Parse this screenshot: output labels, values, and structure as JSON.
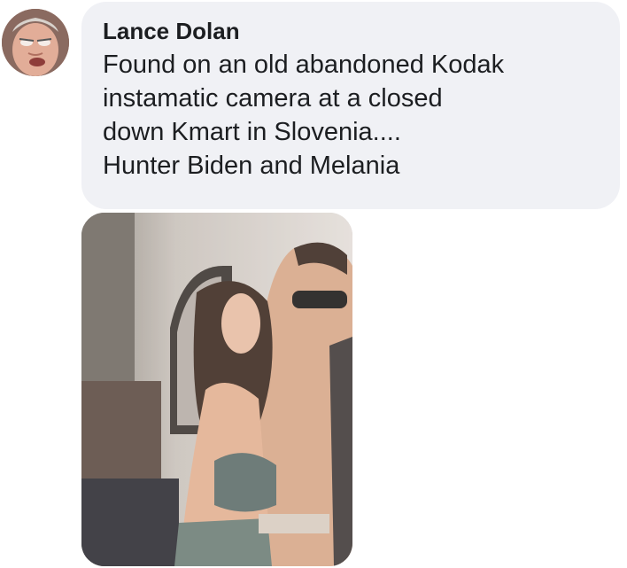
{
  "comment": {
    "author": "Lance Dolan",
    "message": "Found on an old abandoned Kodak\ninstamatic camera at a closed\ndown Kmart in Slovenia....\nHunter Biden and Melania"
  },
  "colors": {
    "bubble_background": "#f0f1f5",
    "text": "#1c1e21"
  },
  "icons": {
    "avatar": "user-profile-photo",
    "attachment": "attached-photo"
  }
}
